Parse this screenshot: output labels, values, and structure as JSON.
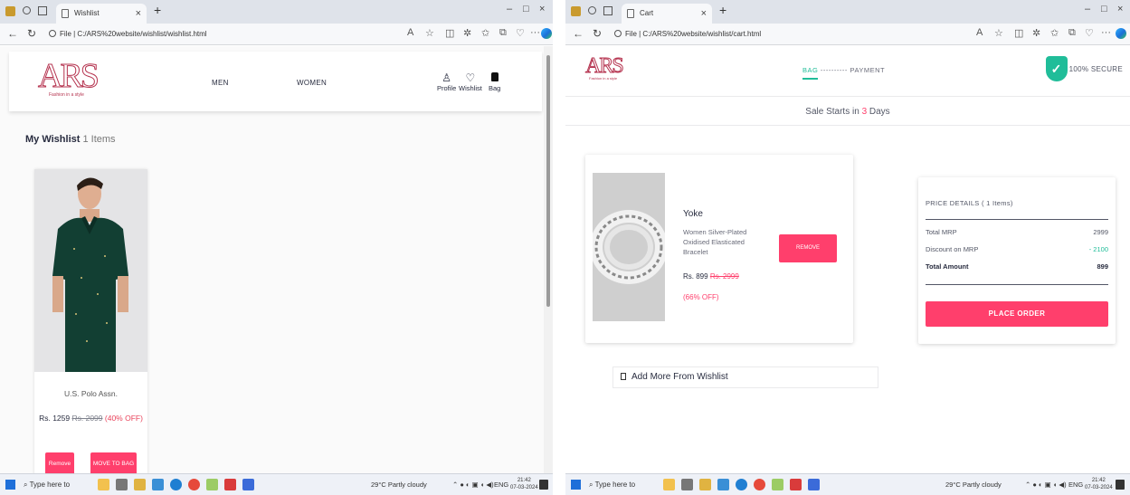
{
  "left_window": {
    "tab_title": "Wishlist",
    "url": "C:/ARS%20website/wishlist/wishlist.html",
    "header": {
      "logo": "ARS",
      "logo_tagline": "Fashion in a style",
      "nav": [
        "MEN",
        "WOMEN"
      ],
      "icons": [
        {
          "label": "Profile",
          "icon": "person-icon"
        },
        {
          "label": "Wishlist",
          "icon": "heart-icon"
        },
        {
          "label": "Bag",
          "icon": "bag-icon"
        }
      ]
    },
    "wishlist": {
      "title": "My Wishlist",
      "count": "1 Items",
      "item": {
        "brand": "U.S. Polo Assn.",
        "price": "Rs. 1259",
        "mrp": "Rs. 2099",
        "discount": "(40% OFF)",
        "remove_label": "Remove",
        "move_label": "MOVE TO BAG"
      }
    }
  },
  "right_window": {
    "tab_title": "Cart",
    "url": "C:/ARS%20website/wishlist/cart.html",
    "header": {
      "logo": "ARS",
      "logo_tagline": "Fashion in a style",
      "step_bag": "BAG",
      "step_sep": " ---------- ",
      "step_payment": "PAYMENT",
      "secure": "100% SECURE"
    },
    "sale_banner": {
      "prefix": "Sale Starts in ",
      "days": "3",
      "suffix": " Days"
    },
    "cart_item": {
      "brand": "Yoke",
      "name": "Women Silver-Plated Oxidised Elasticated Bracelet",
      "price": "Rs. 899",
      "mrp": "Rs. 2999",
      "discount": "(66% OFF)",
      "remove_label": "REMOVE"
    },
    "price_details": {
      "heading": "PRICE DETAILS ( 1 Items)",
      "rows": [
        {
          "label": "Total MRP",
          "value": "2999"
        },
        {
          "label": "Discount on MRP",
          "value": "- 2100"
        }
      ],
      "total_label": "Total Amount",
      "total_value": "899",
      "place_order": "PLACE ORDER"
    },
    "add_more": "Add More From Wishlist"
  },
  "taskbar": {
    "search_placeholder": "Type here to search",
    "weather": "29°C Partly cloudy",
    "lang": "ENG",
    "time": "21:42",
    "date": "07-03-2024"
  },
  "colors": {
    "accent_pink": "#ff3f6c",
    "accent_green": "#20bd99",
    "logo_maroon": "#b5334f"
  }
}
